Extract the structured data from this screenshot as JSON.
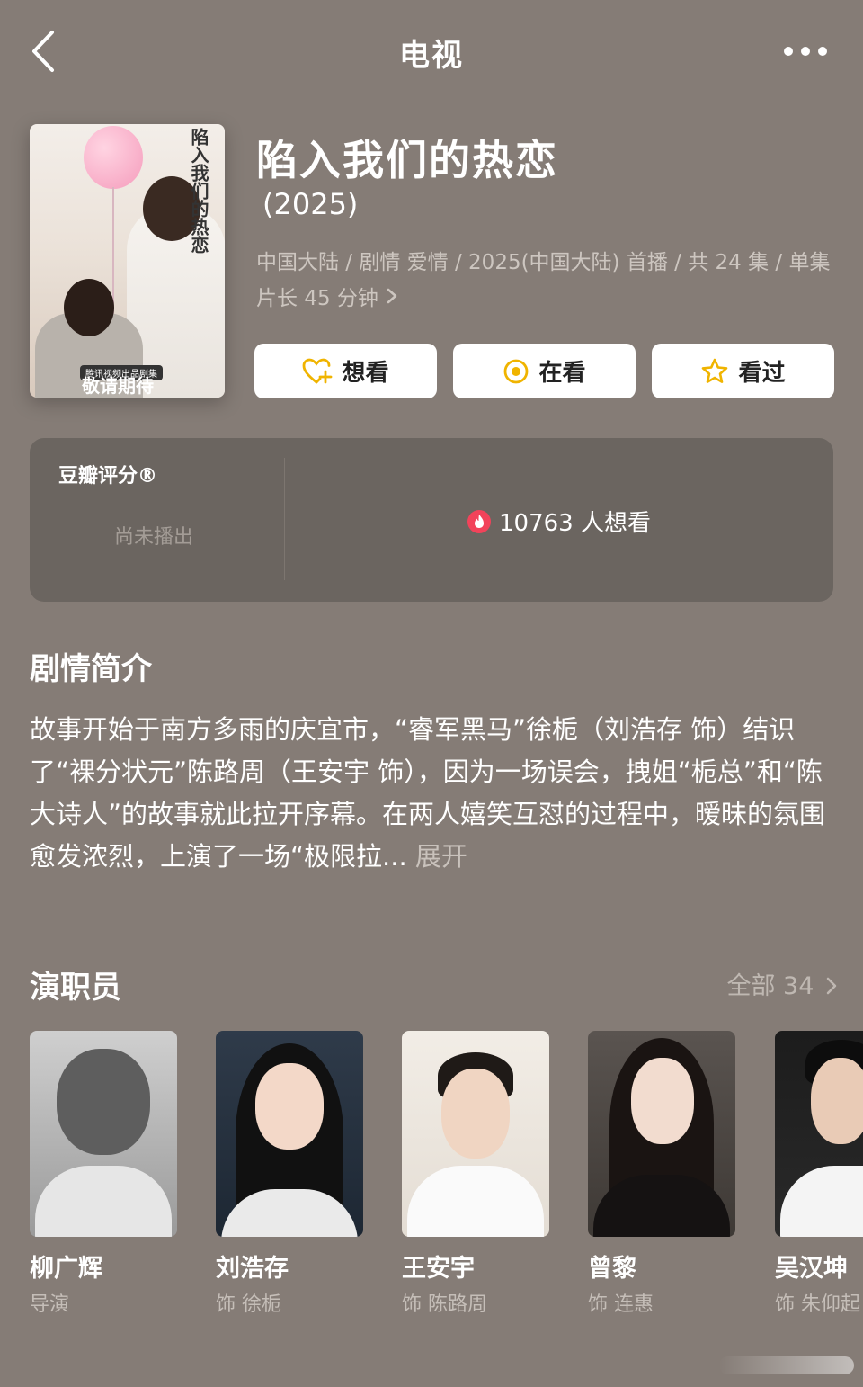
{
  "nav": {
    "title": "电视"
  },
  "poster": {
    "title_text": "陷入我们的热恋",
    "brand_text": "腾讯视频出品剧集",
    "footer_text": "敬请期待"
  },
  "show": {
    "title": "陷入我们的热恋",
    "year": "(2025)",
    "meta": "中国大陆 / 剧情 爱情 / 2025(中国大陆) 首播 / 共 24 集 / 单集片长 45 分钟"
  },
  "actions": [
    {
      "label": "想看",
      "icon": "heart-plus-icon",
      "color": "#f0b400"
    },
    {
      "label": "在看",
      "icon": "target-icon",
      "color": "#f0b400"
    },
    {
      "label": "看过",
      "icon": "star-icon",
      "color": "#f0b400"
    }
  ],
  "rating": {
    "title": "豆瓣评分®",
    "status": "尚未播出",
    "wish_count": "10763 人想看",
    "wish_icon_color": "#f2435a"
  },
  "synopsis": {
    "title": "剧情简介",
    "text": "故事开始于南方多雨的庆宜市，“睿军黑马”徐栀（刘浩存 饰）结识了“裸分状元”陈路周（王安宇 饰），因为一场误会，拽姐“栀总”和“陈大诗人”的故事就此拉开序幕。在两人嬉笑互怼的过程中，暧昧的氛围愈发浓烈，上演了一场“极限拉...",
    "expand": "展开"
  },
  "cast": {
    "title": "演职员",
    "all_label": "全部 34",
    "members": [
      {
        "name": "柳广辉",
        "role": "导演"
      },
      {
        "name": "刘浩存",
        "role": "饰 徐栀"
      },
      {
        "name": "王安宇",
        "role": "饰 陈路周"
      },
      {
        "name": "曾黎",
        "role": "饰 连惠"
      },
      {
        "name": "吴汉坤",
        "role": "饰 朱仰起"
      }
    ]
  }
}
